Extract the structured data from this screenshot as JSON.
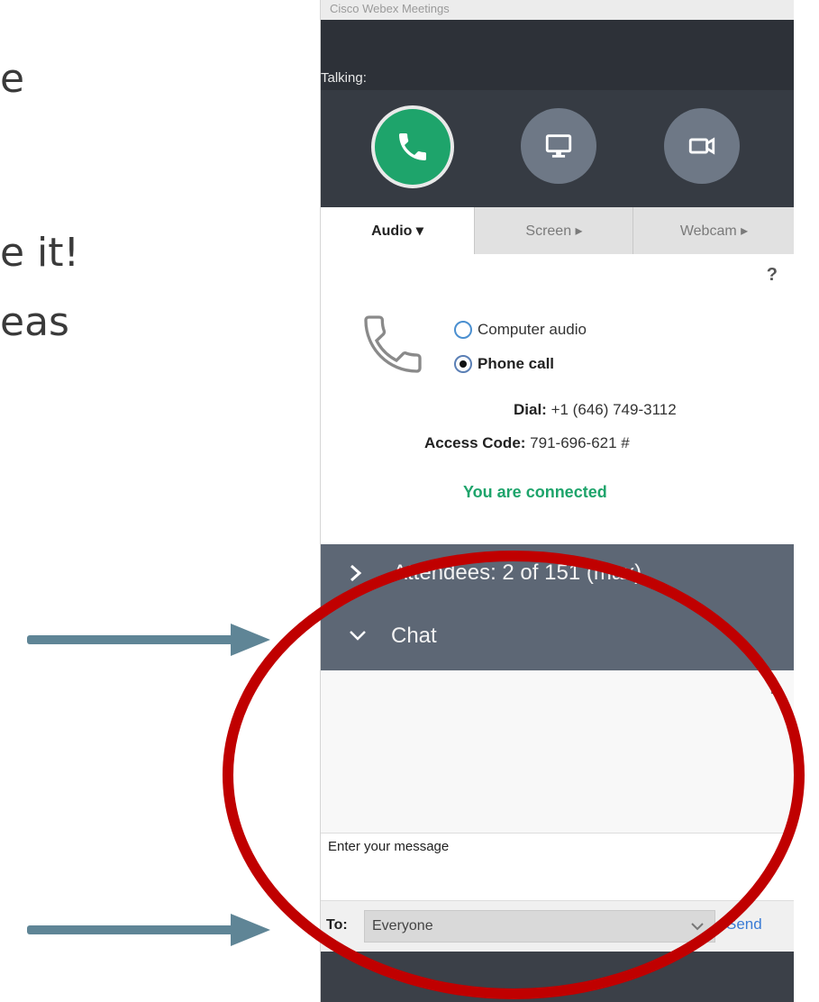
{
  "slide": {
    "fragments": [
      "e",
      "e it!",
      "eas"
    ]
  },
  "window": {
    "title": "Cisco Webex Meetings",
    "talking_label": "Talking:"
  },
  "controls": {
    "audio_icon": "phone-icon",
    "screen_icon": "monitor-icon",
    "webcam_icon": "camera-icon"
  },
  "tabs": [
    {
      "label": "Audio ▾"
    },
    {
      "label": "Screen ▸"
    },
    {
      "label": "Webcam ▸"
    }
  ],
  "audio": {
    "help": "?",
    "options": [
      {
        "label": "Computer audio",
        "selected": false
      },
      {
        "label": "Phone call",
        "selected": true
      }
    ],
    "dial_label": "Dial:",
    "dial_value": "+1 (646) 749-3112",
    "access_label": "Access Code:",
    "access_value": "791-696-621 #",
    "status": "You are connected"
  },
  "attendees": {
    "label": "Attendees: 2 of 151 (max)"
  },
  "chat": {
    "label": "Chat",
    "help": "?",
    "message_placeholder": "Enter your message",
    "to_label": "To:",
    "to_value": "Everyone",
    "send_label": "Send"
  },
  "colors": {
    "accent_green": "#1ea46b",
    "section_header": "#5d6775",
    "annotation_red": "#c00000",
    "arrow_blue": "#5f8596"
  }
}
